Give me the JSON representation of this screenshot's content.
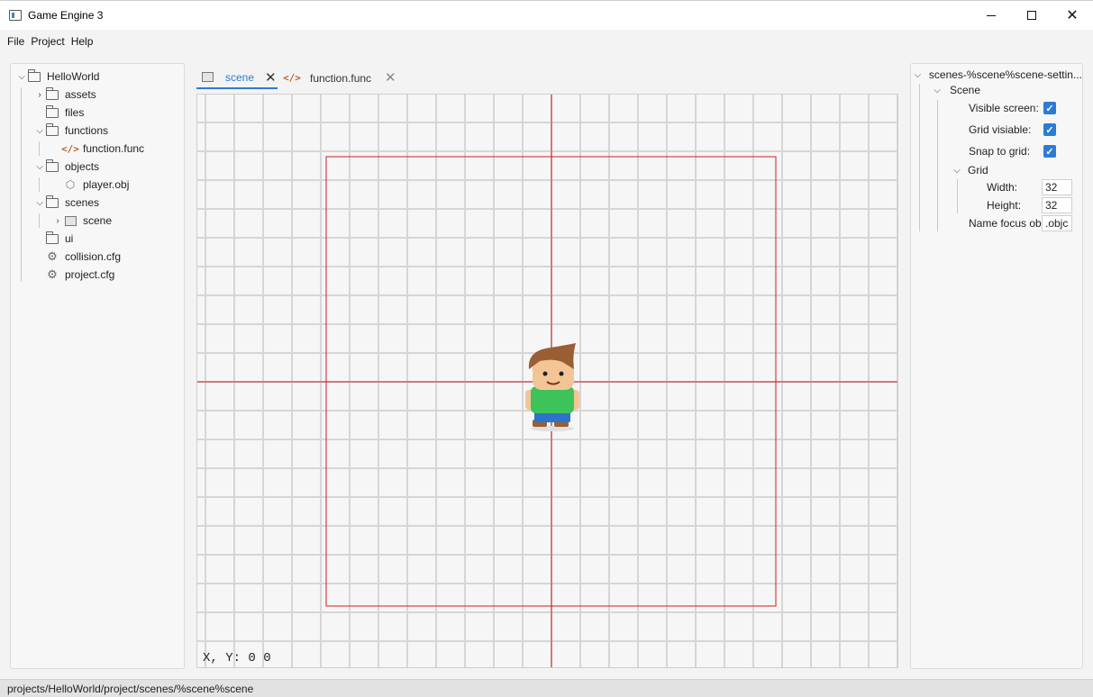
{
  "window": {
    "title": "Game Engine 3",
    "minimize_glyph": "—",
    "close_glyph": "✕"
  },
  "menu": [
    "File",
    "Project",
    "Help"
  ],
  "project_tree": {
    "root": "HelloWorld",
    "items": [
      {
        "label": "assets",
        "icon": "folder-icon"
      },
      {
        "label": "files",
        "icon": "folder-icon"
      },
      {
        "label": "functions",
        "icon": "folder-icon"
      },
      {
        "label": "function.func",
        "icon": "code-icon"
      },
      {
        "label": "objects",
        "icon": "folder-icon"
      },
      {
        "label": "player.obj",
        "icon": "cube-icon"
      },
      {
        "label": "scenes",
        "icon": "folder-icon"
      },
      {
        "label": "scene",
        "icon": "scene-icon"
      },
      {
        "label": "ui",
        "icon": "folder-icon"
      },
      {
        "label": "collision.cfg",
        "icon": "gear-icon"
      },
      {
        "label": "project.cfg",
        "icon": "gear-icon"
      }
    ]
  },
  "tabs": [
    {
      "label": "scene",
      "active": true
    },
    {
      "label": "function.func",
      "active": false
    }
  ],
  "canvas": {
    "coord_readout": "X, Y: 0   0",
    "grid_color": "#d6d6d6",
    "guide_color": "#cc1f1f"
  },
  "inspector": {
    "header": "scenes-%scene%scene-settin...",
    "section_scene": "Scene",
    "visible_screen_label": "Visible screen:",
    "visible_screen_checked": true,
    "grid_visible_label": "Grid visiable:",
    "grid_visible_checked": true,
    "snap_label": "Snap to grid:",
    "snap_checked": true,
    "section_grid": "Grid",
    "width_label": "Width:",
    "width_value": "32",
    "height_label": "Height:",
    "height_value": "32",
    "name_focus_label": "Name focus ob",
    "name_focus_value": ".objc"
  },
  "status_path": "projects/HelloWorld/project/scenes/%scene%scene",
  "colors": {
    "accent": "#2d7bd3",
    "guide": "#cc1f1f"
  }
}
